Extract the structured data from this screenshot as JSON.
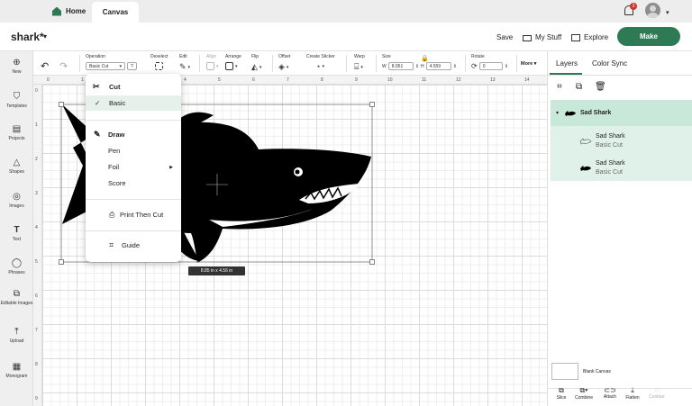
{
  "tabs": {
    "home": "Home",
    "canvas": "Canvas"
  },
  "notifications": {
    "count": "3"
  },
  "header": {
    "project_name": "shark*",
    "save": "Save",
    "my_stuff": "My Stuff",
    "explore": "Explore",
    "make": "Make"
  },
  "toolbar": {
    "operation_label": "Operation",
    "operation_value": "Basic Cut",
    "deselect": "Deselect",
    "edit": "Edit",
    "align": "Align",
    "arrange": "Arrange",
    "flip": "Flip",
    "offset": "Offset",
    "create_sticker": "Create Sticker",
    "warp": "Warp",
    "size": "Size",
    "w_label": "W",
    "w_value": "8.951",
    "h_label": "H",
    "h_value": "4.559",
    "rotate": "Rotate",
    "rotate_value": "0",
    "more": "More"
  },
  "sidebar": {
    "items": [
      {
        "label": "New",
        "icon": "plus-circle-icon"
      },
      {
        "label": "Templates",
        "icon": "shirt-icon"
      },
      {
        "label": "Projects",
        "icon": "projects-icon"
      },
      {
        "label": "Shapes",
        "icon": "shapes-icon"
      },
      {
        "label": "Images",
        "icon": "lightbulb-icon"
      },
      {
        "label": "Text",
        "icon": "text-t-icon"
      },
      {
        "label": "Phrases",
        "icon": "chat-bubble-icon"
      },
      {
        "label": "Editable Images",
        "icon": "editable-image-icon"
      },
      {
        "label": "Upload",
        "icon": "upload-icon"
      },
      {
        "label": "Monogram",
        "icon": "monogram-icon"
      }
    ]
  },
  "ruler": {
    "top": [
      "0",
      "1",
      "2",
      "3",
      "4",
      "5",
      "6",
      "7",
      "8",
      "9",
      "10",
      "11",
      "12",
      "13",
      "14"
    ],
    "left": [
      "0",
      "1",
      "2",
      "3",
      "4",
      "5",
      "6",
      "7",
      "8",
      "9"
    ]
  },
  "canvas": {
    "size_tag": "8.85 in x 4.56 in"
  },
  "dropdown": {
    "cut_header": "Cut",
    "basic": "Basic",
    "draw_header": "Draw",
    "pen": "Pen",
    "foil": "Foil",
    "score": "Score",
    "print_then_cut": "Print Then Cut",
    "guide": "Guide"
  },
  "panel": {
    "tab_layers": "Layers",
    "tab_color_sync": "Color Sync",
    "group_name": "Sad Shark",
    "layers": [
      {
        "name": "Sad Shark",
        "op": "Basic Cut"
      },
      {
        "name": "Sad Shark",
        "op": "Basic Cut"
      }
    ],
    "blank_canvas": "Blank Canvas",
    "bottom_tools": [
      "Slice",
      "Combine",
      "Attach",
      "Flatten",
      "Contour"
    ]
  },
  "colors": {
    "accent": "#2e7a55",
    "selected_layer": "#c8e8d9"
  }
}
